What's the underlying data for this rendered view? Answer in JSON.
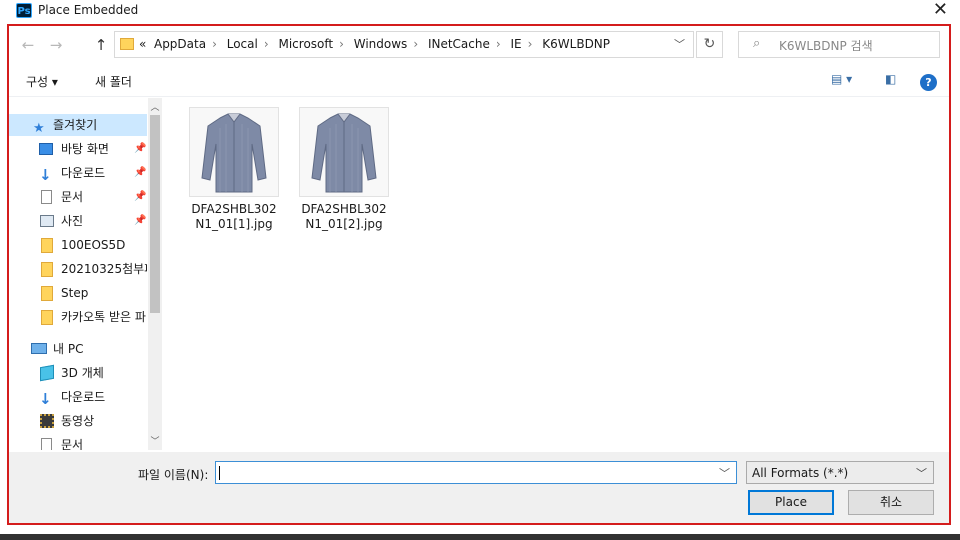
{
  "window": {
    "title": "Place Embedded",
    "app_icon_text": "Ps",
    "close_glyph": "✕"
  },
  "address": {
    "prefix": "«",
    "crumbs": [
      "AppData",
      "Local",
      "Microsoft",
      "Windows",
      "INetCache",
      "IE",
      "K6WLBDNP"
    ],
    "search_placeholder": "K6WLBDNP 검색"
  },
  "toolbar": {
    "organize_label": "구성 ▾",
    "new_folder_label": "새 폴더"
  },
  "nav": {
    "items": [
      {
        "label": "즐겨찾기",
        "icon": "star-icon",
        "pinned": false,
        "selected": true
      },
      {
        "label": "바탕 화면",
        "icon": "desktop-icon",
        "pinned": true
      },
      {
        "label": "다운로드",
        "icon": "download-icon",
        "pinned": true
      },
      {
        "label": "문서",
        "icon": "document-icon",
        "pinned": true
      },
      {
        "label": "사진",
        "icon": "pictures-icon",
        "pinned": true
      },
      {
        "label": "100EOS5D",
        "icon": "folder-icon"
      },
      {
        "label": "20210325첨부파",
        "icon": "folder-icon"
      },
      {
        "label": "Step",
        "icon": "folder-icon"
      },
      {
        "label": "카카오톡 받은 파",
        "icon": "folder-icon"
      },
      {
        "label": "내 PC",
        "icon": "pc-icon"
      },
      {
        "label": "3D 개체",
        "icon": "3d-objects-icon"
      },
      {
        "label": "다운로드",
        "icon": "download-icon"
      },
      {
        "label": "동영상",
        "icon": "video-icon"
      },
      {
        "label": "문서",
        "icon": "document-icon"
      }
    ]
  },
  "files": [
    {
      "name": "DFA2SHBL302N1_01[1].jpg",
      "icon": "shirt-thumbnail"
    },
    {
      "name": "DFA2SHBL302N1_01[2].jpg",
      "icon": "shirt-thumbnail"
    }
  ],
  "footer": {
    "filename_label": "파일 이름(N):",
    "filename_value": "",
    "format_value": "All Formats (*.*)",
    "place_label": "Place",
    "cancel_label": "취소"
  },
  "colors": {
    "highlight_frame": "#d41c1c",
    "selected_nav": "#cce8ff",
    "accent": "#0078d7"
  }
}
